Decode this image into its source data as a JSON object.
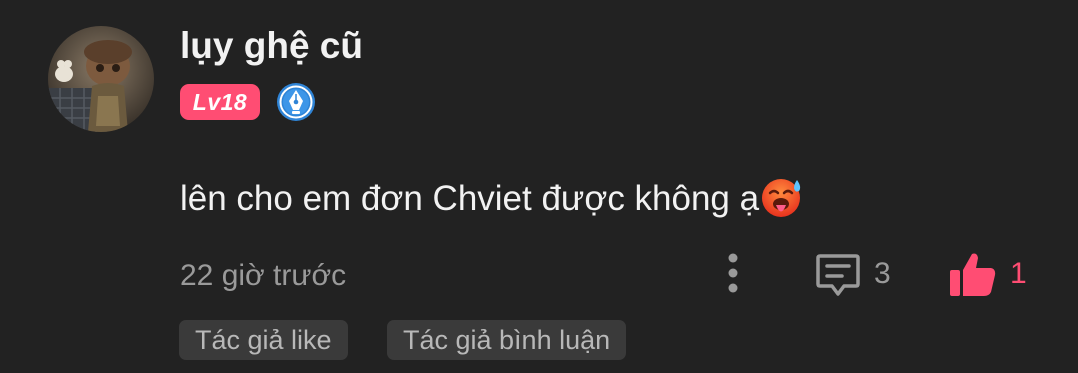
{
  "comment": {
    "author": {
      "name": "lụy ghệ cũ",
      "level_badge": "Lv18",
      "badge_color": "#ff4d73",
      "author_icon": "pen-nib-badge-icon"
    },
    "text": "lên cho em đơn Chviet được không ạ",
    "emoji": "hot-face-emoji",
    "timestamp": "22 giờ trước",
    "actions": {
      "more_icon": "vertical-dots-icon",
      "reply_icon": "comment-icon",
      "reply_count": "3",
      "like_icon": "thumbs-up-icon",
      "like_count": "1",
      "like_color": "#ff4d73"
    },
    "tags": [
      "Tác giả like",
      "Tác giả bình luận"
    ]
  },
  "theme": {
    "background": "#222222",
    "primary_text": "#f2f2f2",
    "secondary_text": "#9a9a9a",
    "tag_background": "#3a3a3a"
  }
}
